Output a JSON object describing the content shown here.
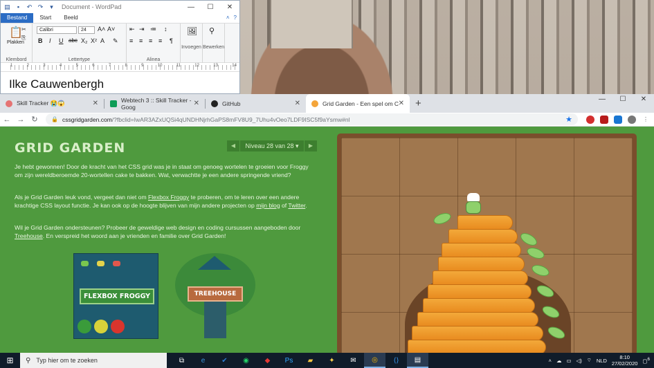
{
  "wordpad": {
    "title": "Document - WordPad",
    "tabs": [
      "Bestand",
      "Start",
      "Beeld"
    ],
    "font_name": "Calibri",
    "font_size": "24",
    "groups": {
      "clipboard": "Klembord",
      "font": "Lettertype",
      "paragraph": "Alinea",
      "insert": "Invoegen",
      "edit": "Bewerken"
    },
    "paste_label": "Plakken",
    "ruler_numbers": [
      "1",
      "2",
      "3",
      "4",
      "5",
      "6",
      "7",
      "8",
      "9",
      "10",
      "11",
      "12",
      "13",
      "14"
    ],
    "document_text": "Ilke Cauwenbergh"
  },
  "browser": {
    "tabs": [
      {
        "title": "Skill Tracker 😭😱",
        "icon": "skilltracker-icon"
      },
      {
        "title": "Webtech 3 :: Skill Tracker - Goog",
        "icon": "google-sheets-icon"
      },
      {
        "title": "GitHub",
        "icon": "github-icon"
      },
      {
        "title": "Grid Garden - Een spel om CSS g",
        "icon": "grid-garden-icon"
      }
    ],
    "url_host": "cssgridgarden.com",
    "url_path": "/?fbclid=IwAR3AZxUQSi4qUNDHNjrhGaPS8mFV8U9_7Uhu4vOeo7LDF9ISC5f9aYsmw#nl"
  },
  "page": {
    "title": "GRID GARDEN",
    "level_label": "Niveau 28 van 28",
    "paragraph1": "Je hebt gewonnen! Door de kracht van het CSS grid was je in staat om genoeg wortelen te groeien voor Froggy om zijn wereldberoemde 20-wortellen cake te bakken. Wat, verwachtte je een andere springende vriend?",
    "paragraph2_a": "Als je Grid Garden leuk vond, vergeet dan niet om ",
    "paragraph2_link1": "Flexbox Froggy",
    "paragraph2_b": " te proberen, om te leren over een andere krachtige CSS layout functie. Je kan ook op de hoogte blijven van mijn andere projecten op ",
    "paragraph2_link2": "mijn blog",
    "paragraph2_c": " of ",
    "paragraph2_link3": "Twitter",
    "paragraph2_d": ".",
    "paragraph3_a": "Wil je Grid Garden ondersteunen? Probeer de geweldige web design en coding cursussen aangeboden door ",
    "paragraph3_link": "Treehouse",
    "paragraph3_b": ". En verspreid het woord aan je vrienden en familie over Grid Garden!",
    "froggy_label": "FLEXBOX FROGGY",
    "treehouse_label": "TREEHOUSE"
  },
  "taskbar": {
    "search_placeholder": "Typ hier om te zoeken",
    "language": "NLD",
    "time": "8:10",
    "date": "27/02/2020",
    "notification_count": "6"
  }
}
